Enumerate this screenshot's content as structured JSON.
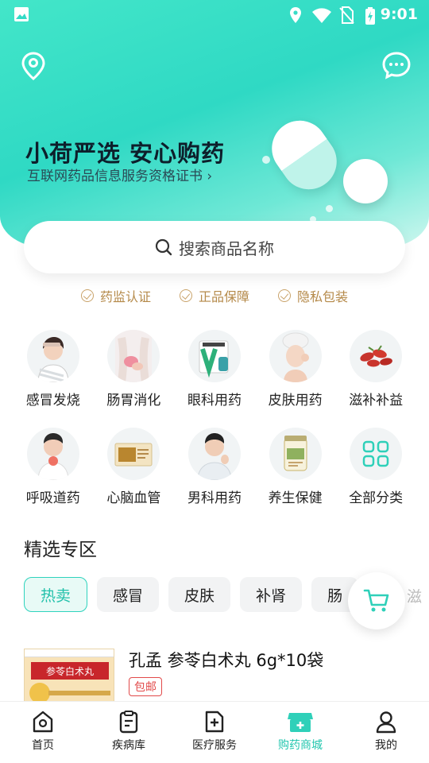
{
  "status_bar": {
    "time": "9:01"
  },
  "header": {
    "slogan": "小荷严选 安心购药",
    "cert_link": "互联网药品信息服务资格证书 ›"
  },
  "search": {
    "placeholder": "搜索商品名称"
  },
  "badges": [
    "药监认证",
    "正品保障",
    "隐私包装"
  ],
  "categories": [
    {
      "label": "感冒发烧",
      "icon": "cold-fever-icon"
    },
    {
      "label": "肠胃消化",
      "icon": "stomach-icon"
    },
    {
      "label": "眼科用药",
      "icon": "eye-drops-icon"
    },
    {
      "label": "皮肤用药",
      "icon": "skin-icon"
    },
    {
      "label": "滋补补益",
      "icon": "tonic-icon"
    },
    {
      "label": "呼吸道药",
      "icon": "respiratory-icon"
    },
    {
      "label": "心脑血管",
      "icon": "cardio-icon"
    },
    {
      "label": "男科用药",
      "icon": "andrology-icon"
    },
    {
      "label": "养生保健",
      "icon": "health-care-icon"
    },
    {
      "label": "全部分类",
      "icon": "grid-icon"
    }
  ],
  "section": {
    "title": "精选专区",
    "tabs": [
      "热卖",
      "感冒",
      "皮肤",
      "补肾",
      "肠",
      "滋"
    ]
  },
  "product": {
    "name": "孔孟 参苓白术丸 6g*10袋",
    "tag": "包邮",
    "box_title": "参苓白术丸"
  },
  "bottom_nav": [
    {
      "label": "首页",
      "icon": "home-icon"
    },
    {
      "label": "疾病库",
      "icon": "clipboard-icon"
    },
    {
      "label": "医疗服务",
      "icon": "medical-service-icon"
    },
    {
      "label": "购药商城",
      "icon": "pharmacy-store-icon",
      "active": true
    },
    {
      "label": "我的",
      "icon": "profile-icon"
    }
  ],
  "colors": {
    "accent": "#22c6ae",
    "badge_gold": "#b58a4a",
    "tag_red": "#e24a4a"
  }
}
